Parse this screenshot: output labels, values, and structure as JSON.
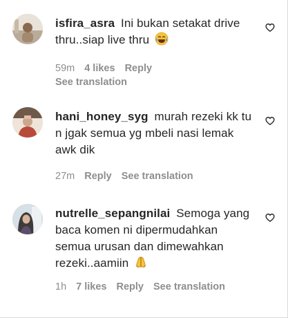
{
  "comments": [
    {
      "username": "isfira_asra",
      "text": "Ini bukan setakat drive thru..siap live thru",
      "emoji": "laughing-tears-emoji",
      "time": "59m",
      "likes": "4 likes",
      "reply": "Reply",
      "translation": "See translation",
      "avatar_colors": [
        "#e6ddd2",
        "#8a6a4f"
      ]
    },
    {
      "username": "hani_honey_syg",
      "text": "murah rezeki kk tu n jgak semua yg mbeli nasi lemak awk dik",
      "time": "27m",
      "reply": "Reply",
      "translation": "See translation",
      "avatar_colors": [
        "#b84a3c",
        "#e9d7c4"
      ]
    },
    {
      "username": "nutrelle_sepangnilai",
      "text": "Semoga yang baca komen ni dipermudahkan semua urusan dan dimewahkan rezeki..aamiin",
      "emoji": "praying-hands-emoji",
      "time": "1h",
      "likes": "7 likes",
      "reply": "Reply",
      "translation": "See translation",
      "avatar_colors": [
        "#3d3a3a",
        "#c9d6de"
      ]
    }
  ]
}
